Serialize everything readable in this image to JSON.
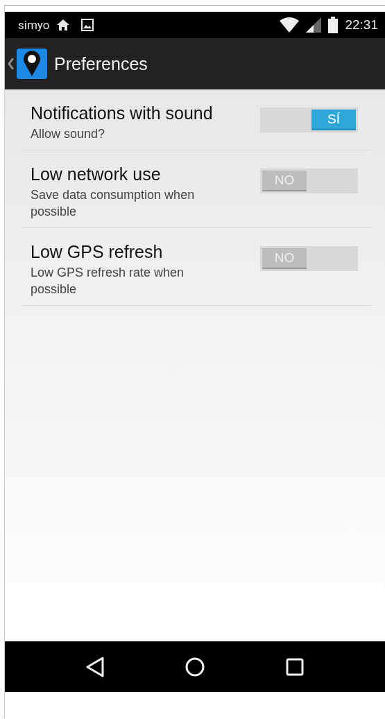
{
  "status_bar": {
    "carrier": "simyo",
    "time": "22:31"
  },
  "action_bar": {
    "title": "Preferences"
  },
  "preferences": [
    {
      "title": "Notifications with sound",
      "summary": "Allow sound?",
      "toggle": {
        "label": "SÍ",
        "on": true
      }
    },
    {
      "title": "Low network use",
      "summary": "Save data consumption when possible",
      "toggle": {
        "label": "NO",
        "on": false
      }
    },
    {
      "title": "Low GPS refresh",
      "summary": "Low GPS refresh rate when possible",
      "toggle": {
        "label": "NO",
        "on": false
      }
    }
  ]
}
